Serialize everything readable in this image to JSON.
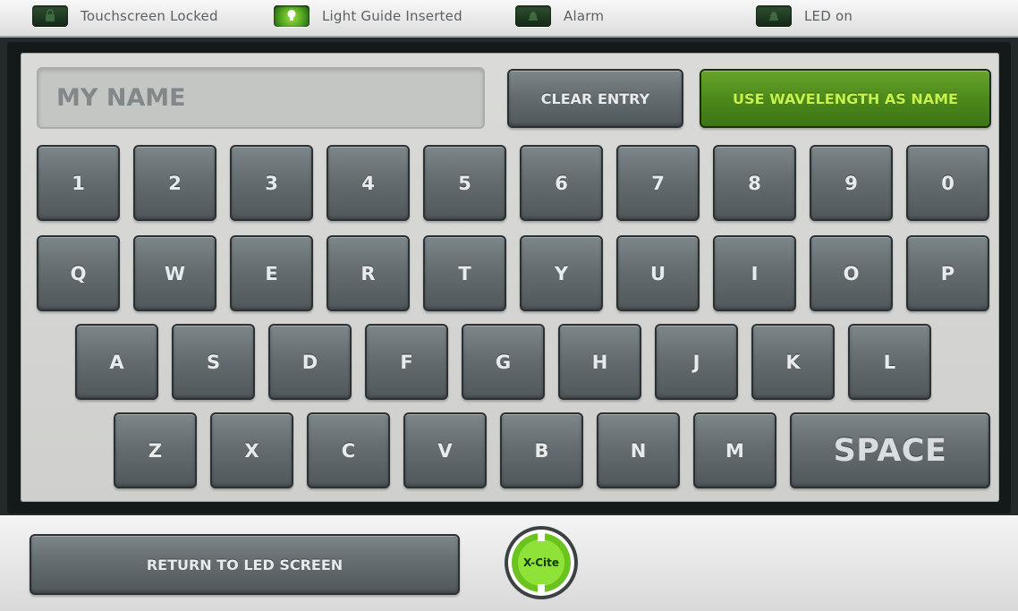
{
  "status_bar": {
    "items": [
      {
        "label": "Touchscreen Locked",
        "state": "off",
        "icon": "lock-icon"
      },
      {
        "label": "Light Guide Inserted",
        "state": "on",
        "icon": "lightbulb-icon"
      },
      {
        "label": "Alarm",
        "state": "off",
        "icon": "bell-icon"
      },
      {
        "label": "LED on",
        "state": "off",
        "icon": "led-icon"
      }
    ]
  },
  "keyboard": {
    "name_placeholder": "MY NAME",
    "clear_entry_label": "CLEAR ENTRY",
    "use_wavelength_label": "USE WAVELENGTH AS NAME",
    "rows": [
      [
        "1",
        "2",
        "3",
        "4",
        "5",
        "6",
        "7",
        "8",
        "9",
        "0"
      ],
      [
        "Q",
        "W",
        "E",
        "R",
        "T",
        "Y",
        "U",
        "I",
        "O",
        "P"
      ],
      [
        "A",
        "S",
        "D",
        "F",
        "G",
        "H",
        "J",
        "K",
        "L"
      ],
      [
        "Z",
        "X",
        "C",
        "V",
        "B",
        "N",
        "M"
      ]
    ],
    "space_label": "SPACE"
  },
  "bottom_bar": {
    "return_label": "RETURN TO LED SCREEN",
    "logo_text": "X-Cite"
  },
  "colors": {
    "accent_green": "#4c8a1b",
    "accent_green_text": "#c6f24a",
    "key_gray": "#656d70",
    "panel_bg": "#d5d6d3"
  }
}
